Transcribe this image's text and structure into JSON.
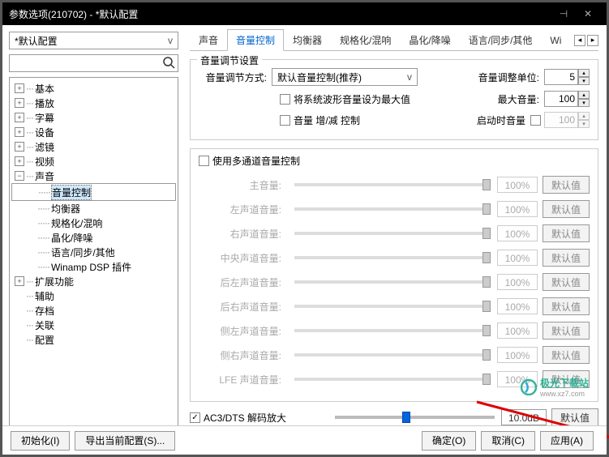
{
  "window": {
    "title": "参数选项(210702) - *默认配置"
  },
  "left": {
    "preset": "*默认配置",
    "search_placeholder": "",
    "tree": {
      "basic": "基本",
      "play": "播放",
      "subtitle": "字幕",
      "device": "设备",
      "filter": "滤镜",
      "video": "视频",
      "audio": "声音",
      "audio_children": {
        "vol": "音量控制",
        "eq": "均衡器",
        "norm": "规格化/混响",
        "crystal": "晶化/降噪",
        "lang": "语言/同步/其他",
        "winamp": "Winamp DSP 插件"
      },
      "ext": "扩展功能",
      "aux": "辅助",
      "arch": "存档",
      "assoc": "关联",
      "config": "配置"
    }
  },
  "tabs": {
    "t1": "声音",
    "t2": "音量控制",
    "t3": "均衡器",
    "t4": "规格化/混响",
    "t5": "晶化/降噪",
    "t6": "语言/同步/其他",
    "t7": "Wi"
  },
  "vol_settings": {
    "group_title": "音量调节设置",
    "method_label": "音量调节方式:",
    "method_value": "默认音量控制(推荐)",
    "unit_label": "音量调整单位:",
    "unit_value": "5",
    "chk_sysmax": "将系统波形音量设为最大值",
    "max_label": "最大音量:",
    "max_value": "100",
    "chk_gain": "音量 增/减 控制",
    "startup_label": "启动时音量",
    "startup_value": "100"
  },
  "multichannel": {
    "chk_label": "使用多通道音量控制",
    "channels": [
      {
        "label": "主音量:",
        "pct": "100%",
        "btn": "默认值"
      },
      {
        "label": "左声道音量:",
        "pct": "100%",
        "btn": "默认值"
      },
      {
        "label": "右声道音量:",
        "pct": "100%",
        "btn": "默认值"
      },
      {
        "label": "中央声道音量:",
        "pct": "100%",
        "btn": "默认值"
      },
      {
        "label": "后左声道音量:",
        "pct": "100%",
        "btn": "默认值"
      },
      {
        "label": "后右声道音量:",
        "pct": "100%",
        "btn": "默认值"
      },
      {
        "label": "侧左声道音量:",
        "pct": "100%",
        "btn": "默认值"
      },
      {
        "label": "侧右声道音量:",
        "pct": "100%",
        "btn": "默认值"
      },
      {
        "label": "LFE 声道音量:",
        "pct": "100%",
        "btn": "默认值"
      }
    ]
  },
  "ac3": {
    "label": "AC3/DTS 解码放大",
    "value": "10.0dB",
    "btn": "默认值"
  },
  "footer": {
    "init": "初始化(I)",
    "export": "导出当前配置(S)...",
    "ok": "确定(O)",
    "cancel": "取消(C)",
    "apply": "应用(A)"
  },
  "logo": {
    "name": "极光下载站",
    "url": "www.xz7.com"
  }
}
